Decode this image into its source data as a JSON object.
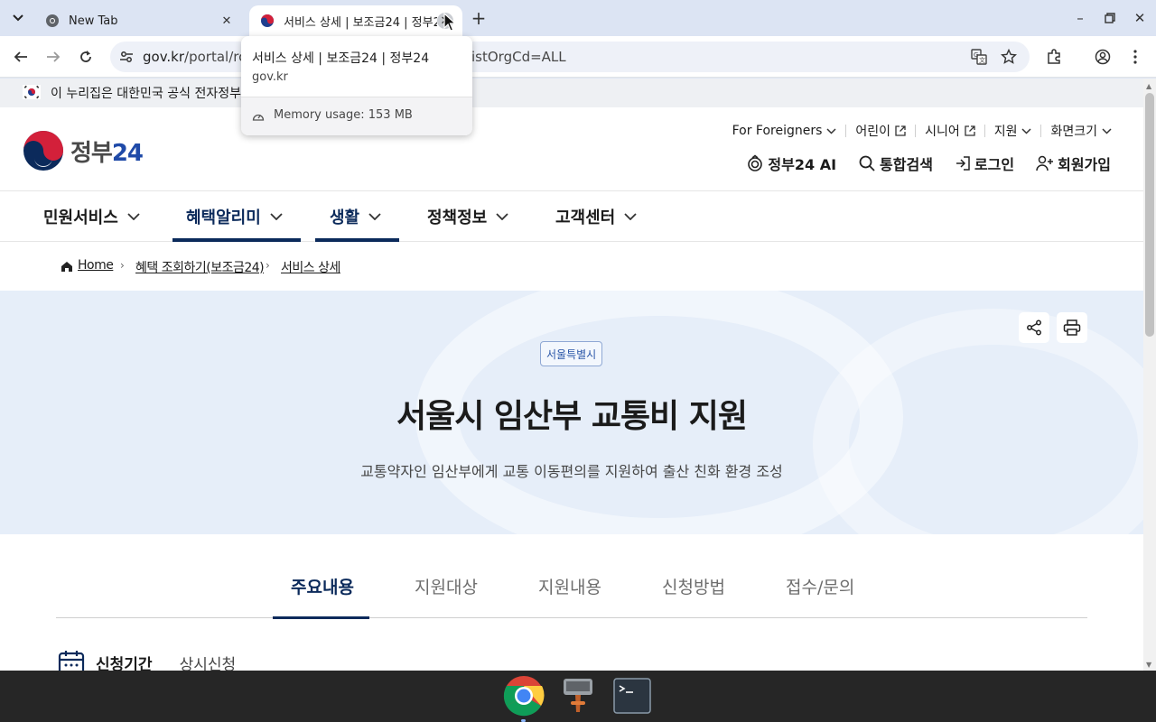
{
  "browser": {
    "tabs": [
      {
        "title": "New Tab",
        "active": false
      },
      {
        "title": "서비스 상세 | 보조금24 | 정부24",
        "active": true
      }
    ],
    "url_domain": "gov.kr",
    "url_path_visible": "/portal/rc",
    "url_tail_visible": "istOrgCd=ALL",
    "hover_card": {
      "title": "서비스 상세 | 보조금24 | 정부24",
      "domain": "gov.kr",
      "memory": "Memory usage: 153 MB"
    }
  },
  "site": {
    "gov_banner": "이 누리집은 대한민국 공식 전자정부",
    "logo_text_a": "정부",
    "logo_text_b": "24",
    "util_links": [
      {
        "label": "For Foreigners",
        "icon": "chevron-down-icon"
      },
      {
        "label": "어린이",
        "icon": "external-link-icon"
      },
      {
        "label": "시니어",
        "icon": "external-link-icon"
      },
      {
        "label": "지원",
        "icon": "chevron-down-icon"
      },
      {
        "label": "화면크기",
        "icon": "chevron-down-icon"
      }
    ],
    "main_links": [
      {
        "label": "정부24 AI",
        "icon": "ai-icon"
      },
      {
        "label": "통합검색",
        "icon": "search-icon"
      },
      {
        "label": "로그인",
        "icon": "login-icon"
      },
      {
        "label": "회원가입",
        "icon": "signup-icon"
      }
    ],
    "gnb": [
      "민원서비스",
      "혜택알리미",
      "생활",
      "정책정보",
      "고객센터"
    ],
    "breadcrumb": [
      "Home",
      "혜택 조회하기(보조금24)",
      "서비스 상세"
    ]
  },
  "service": {
    "region_tag": "서울특별시",
    "title": "서울시 임산부 교통비 지원",
    "subtitle": "교통약자인 임산부에게 교통 이동편의를 지원하여 출산 친화 환경 조성",
    "tabs": [
      "주요내용",
      "지원대상",
      "지원내용",
      "신청방법",
      "접수/문의"
    ],
    "selected_tab": "주요내용",
    "period_label": "신청기간",
    "period_value": "상시신청"
  },
  "colors": {
    "brand_navy": "#0b2a5b",
    "hero_bg": "#e6eef9",
    "tag_blue": "#2a56a8"
  }
}
